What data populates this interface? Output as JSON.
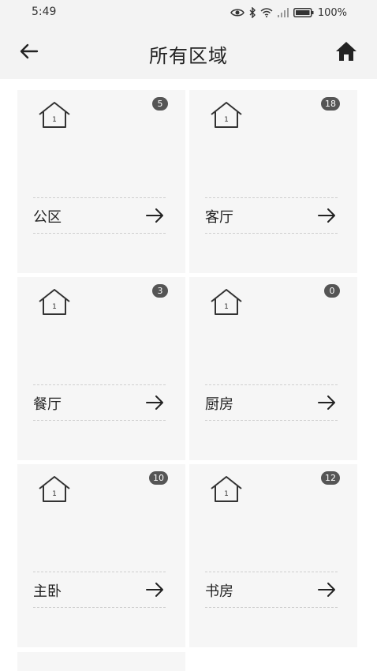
{
  "status": {
    "time": "5:49",
    "battery_percent": "100%"
  },
  "header": {
    "title": "所有区域",
    "back_icon": "arrow-left-icon",
    "home_icon": "home-icon"
  },
  "areas": [
    {
      "name": "公区",
      "count": "5"
    },
    {
      "name": "客厅",
      "count": "18"
    },
    {
      "name": "餐厅",
      "count": "3"
    },
    {
      "name": "厨房",
      "count": "0"
    },
    {
      "name": "主卧",
      "count": "10"
    },
    {
      "name": "书房",
      "count": "12"
    }
  ],
  "colors": {
    "tile_bg": "#f6f6f6",
    "badge_bg": "#555555",
    "bar_bg": "#f3f3f3"
  }
}
